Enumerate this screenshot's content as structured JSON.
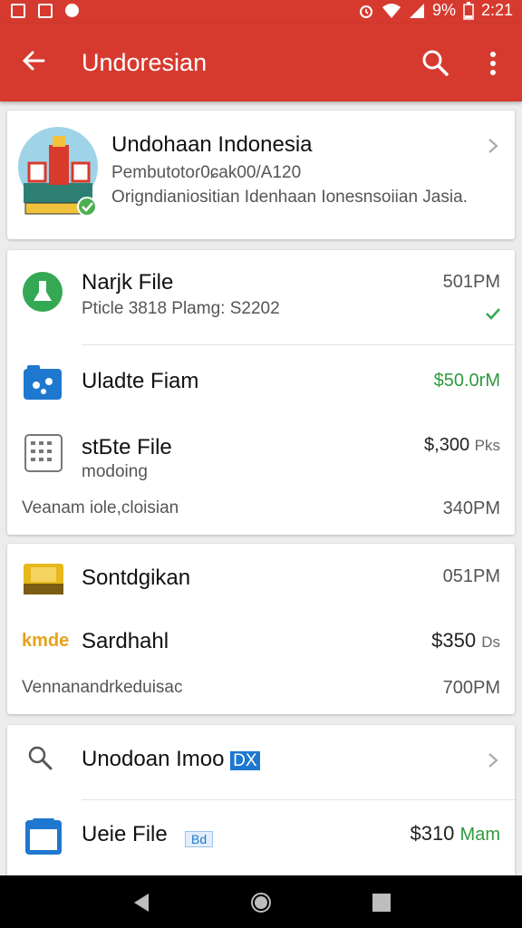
{
  "status_bar": {
    "battery": "9%",
    "time": "2:21"
  },
  "app_bar": {
    "title": "Undoresian"
  },
  "profile": {
    "name": "Undohaan Indonesia",
    "line1": "Pembutotoɾ0ɕak00/Α120",
    "line2": "Origndianiositian Idenhaan Ionesnsoiian Jasia."
  },
  "files_card": {
    "items": [
      {
        "title": "Narjk File",
        "sub": "Pticle 3818 Plamg: S2202",
        "time": "501PM",
        "status": "check"
      },
      {
        "title": "Uladte Fiam",
        "amount": "$50.0rM",
        "amount_color": "#2e9a3e"
      },
      {
        "title": "stБte File",
        "sub": "modoing",
        "amount": "$,300",
        "amount_suffix": "Pks"
      }
    ],
    "footer_left": "Veanam iole,cloisian",
    "footer_right": "340PM"
  },
  "second_card": {
    "items": [
      {
        "title": "Sontdgikan",
        "time": "051PM"
      },
      {
        "badge": "kmde",
        "title": "Sardhahl",
        "amount": "$350",
        "amount_suffix": "Ds"
      }
    ],
    "footer_left": "Vennanandrkeduisac",
    "footer_right": "700PM"
  },
  "third_card": {
    "search_title": "Unodoan Imoo",
    "search_badge": "DX",
    "file_title": "Ueie File",
    "file_chip": "Bd",
    "amount": "$310",
    "amount_suffix": "Mam",
    "amount_suffix_color": "#2e9a3e"
  },
  "colors": {
    "primary": "#d63a2f",
    "green": "#2e9a3e",
    "blue": "#1e78d0"
  }
}
